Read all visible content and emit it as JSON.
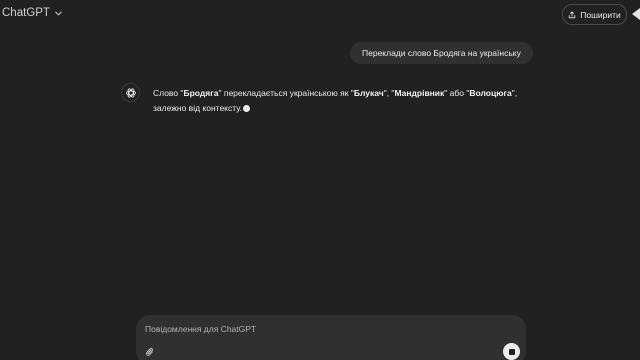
{
  "header": {
    "model_name": "ChatGPT",
    "share_label": "Поширити"
  },
  "conversation": {
    "user_message": "Переклади слово Бродяга на українську",
    "assistant": {
      "t1": "Слово \"",
      "b1": "Бродяга",
      "t2": "\" перекладається українською як \"",
      "b2": "Блукач",
      "t3": "\", \"",
      "b3": "Мандрівник",
      "t4": "\" або \"",
      "b4": "Волоцюга",
      "t5": "\", залежно від контексту."
    }
  },
  "composer": {
    "placeholder": "Повідомлення для ChatGPT",
    "value": ""
  },
  "icons": {
    "model_dropdown": "chevron-down-icon",
    "share": "share-icon",
    "avatar": "openai-logo-icon",
    "attach": "paperclip-icon",
    "stop": "stop-icon"
  },
  "colors": {
    "background": "#212121",
    "bubble": "#303030",
    "text": "#ececec"
  }
}
